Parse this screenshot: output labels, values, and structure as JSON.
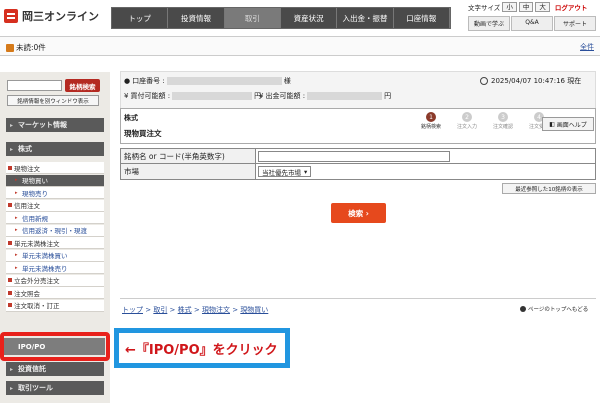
{
  "header": {
    "logo": "岡三オンライン",
    "nav": [
      "トップ",
      "投資情報",
      "取引",
      "資産状況",
      "入出金・振替",
      "口座情報"
    ],
    "text_size": "文字サイズ",
    "sizes": [
      "小",
      "中",
      "大"
    ],
    "logout": "ログアウト",
    "links": [
      "動画で学ぶ",
      "Q&A",
      "サポート"
    ]
  },
  "alert": {
    "unread": "未読:0件",
    "all": "全件"
  },
  "sidebar": {
    "search_btn": "銘柄検索",
    "new_window": "銘柄情報を別ウィンドウ表示",
    "market_info": "マーケット情報",
    "stocks": "株式",
    "items": [
      {
        "label": "現物注文",
        "lv": 1
      },
      {
        "label": "現物買い",
        "lv": 2,
        "sel": true
      },
      {
        "label": "現物売り",
        "lv": 2
      },
      {
        "label": "信用注文",
        "lv": 1
      },
      {
        "label": "信用新規",
        "lv": 2
      },
      {
        "label": "信用返済・現引・現渡",
        "lv": 2
      },
      {
        "label": "単元未満株注文",
        "lv": 1
      },
      {
        "label": "単元未満株買い",
        "lv": 2
      },
      {
        "label": "単元未満株売り",
        "lv": 2
      },
      {
        "label": "立会外分売注文",
        "lv": 1
      },
      {
        "label": "注文照会",
        "lv": 1
      },
      {
        "label": "注文取消・訂正",
        "lv": 1
      }
    ],
    "ipo": "IPO/PO",
    "trust": "投資信託",
    "tools": "取引ツール"
  },
  "account": {
    "account_no": "口座番号 :",
    "sama": "様",
    "buy_power": "買付可能額 :",
    "yen": "円",
    "withdraw_power": "出金可能額 :",
    "yen2": "円",
    "datetime": "2025/04/07 10:47:16 現在"
  },
  "page": {
    "stock": "株式",
    "title": "現物買注文",
    "steps": [
      {
        "n": "1",
        "label": "銘柄検索",
        "on": true
      },
      {
        "n": "2",
        "label": "注文入力"
      },
      {
        "n": "3",
        "label": "注文確認"
      },
      {
        "n": "4",
        "label": "注文受付"
      }
    ],
    "help": "画面ヘルプ"
  },
  "form": {
    "code_label": "銘柄名 or コード(半角英数字)",
    "market_label": "市場",
    "market_value": "当社優先市場"
  },
  "recent": "最近参照した10銘柄の表示",
  "search_button": "検索",
  "breadcrumb": [
    "トップ",
    "取引",
    "株式",
    "現物注文",
    "現物買い"
  ],
  "page_top": "ページのトップへもどる",
  "annotation": "←『IPO/PO』をクリック"
}
